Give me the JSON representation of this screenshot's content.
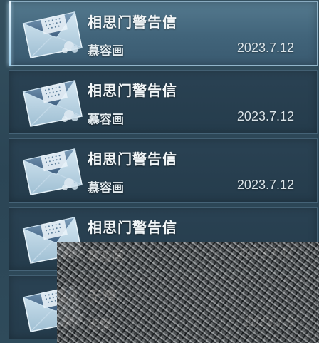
{
  "mail_list": {
    "items": [
      {
        "subject": "相思门警告信",
        "sender": "慕容画",
        "date": "2023.7.12",
        "selected": true
      },
      {
        "subject": "相思门警告信",
        "sender": "慕容画",
        "date": "2023.7.12",
        "selected": false
      },
      {
        "subject": "相思门警告信",
        "sender": "慕容画",
        "date": "2023.7.12",
        "selected": false
      },
      {
        "subject": "相思门警告信",
        "sender": "慕容画",
        "date": "2023.7.11",
        "selected": false
      },
      {
        "subject": "无情",
        "sender": "无情",
        "date": "2023.7.8",
        "selected": false
      }
    ]
  },
  "colors": {
    "selected_row": "#4a6e84",
    "row": "#263d4d",
    "text": "#f2f6f8"
  },
  "icons": {
    "mail": "envelope-icon"
  }
}
